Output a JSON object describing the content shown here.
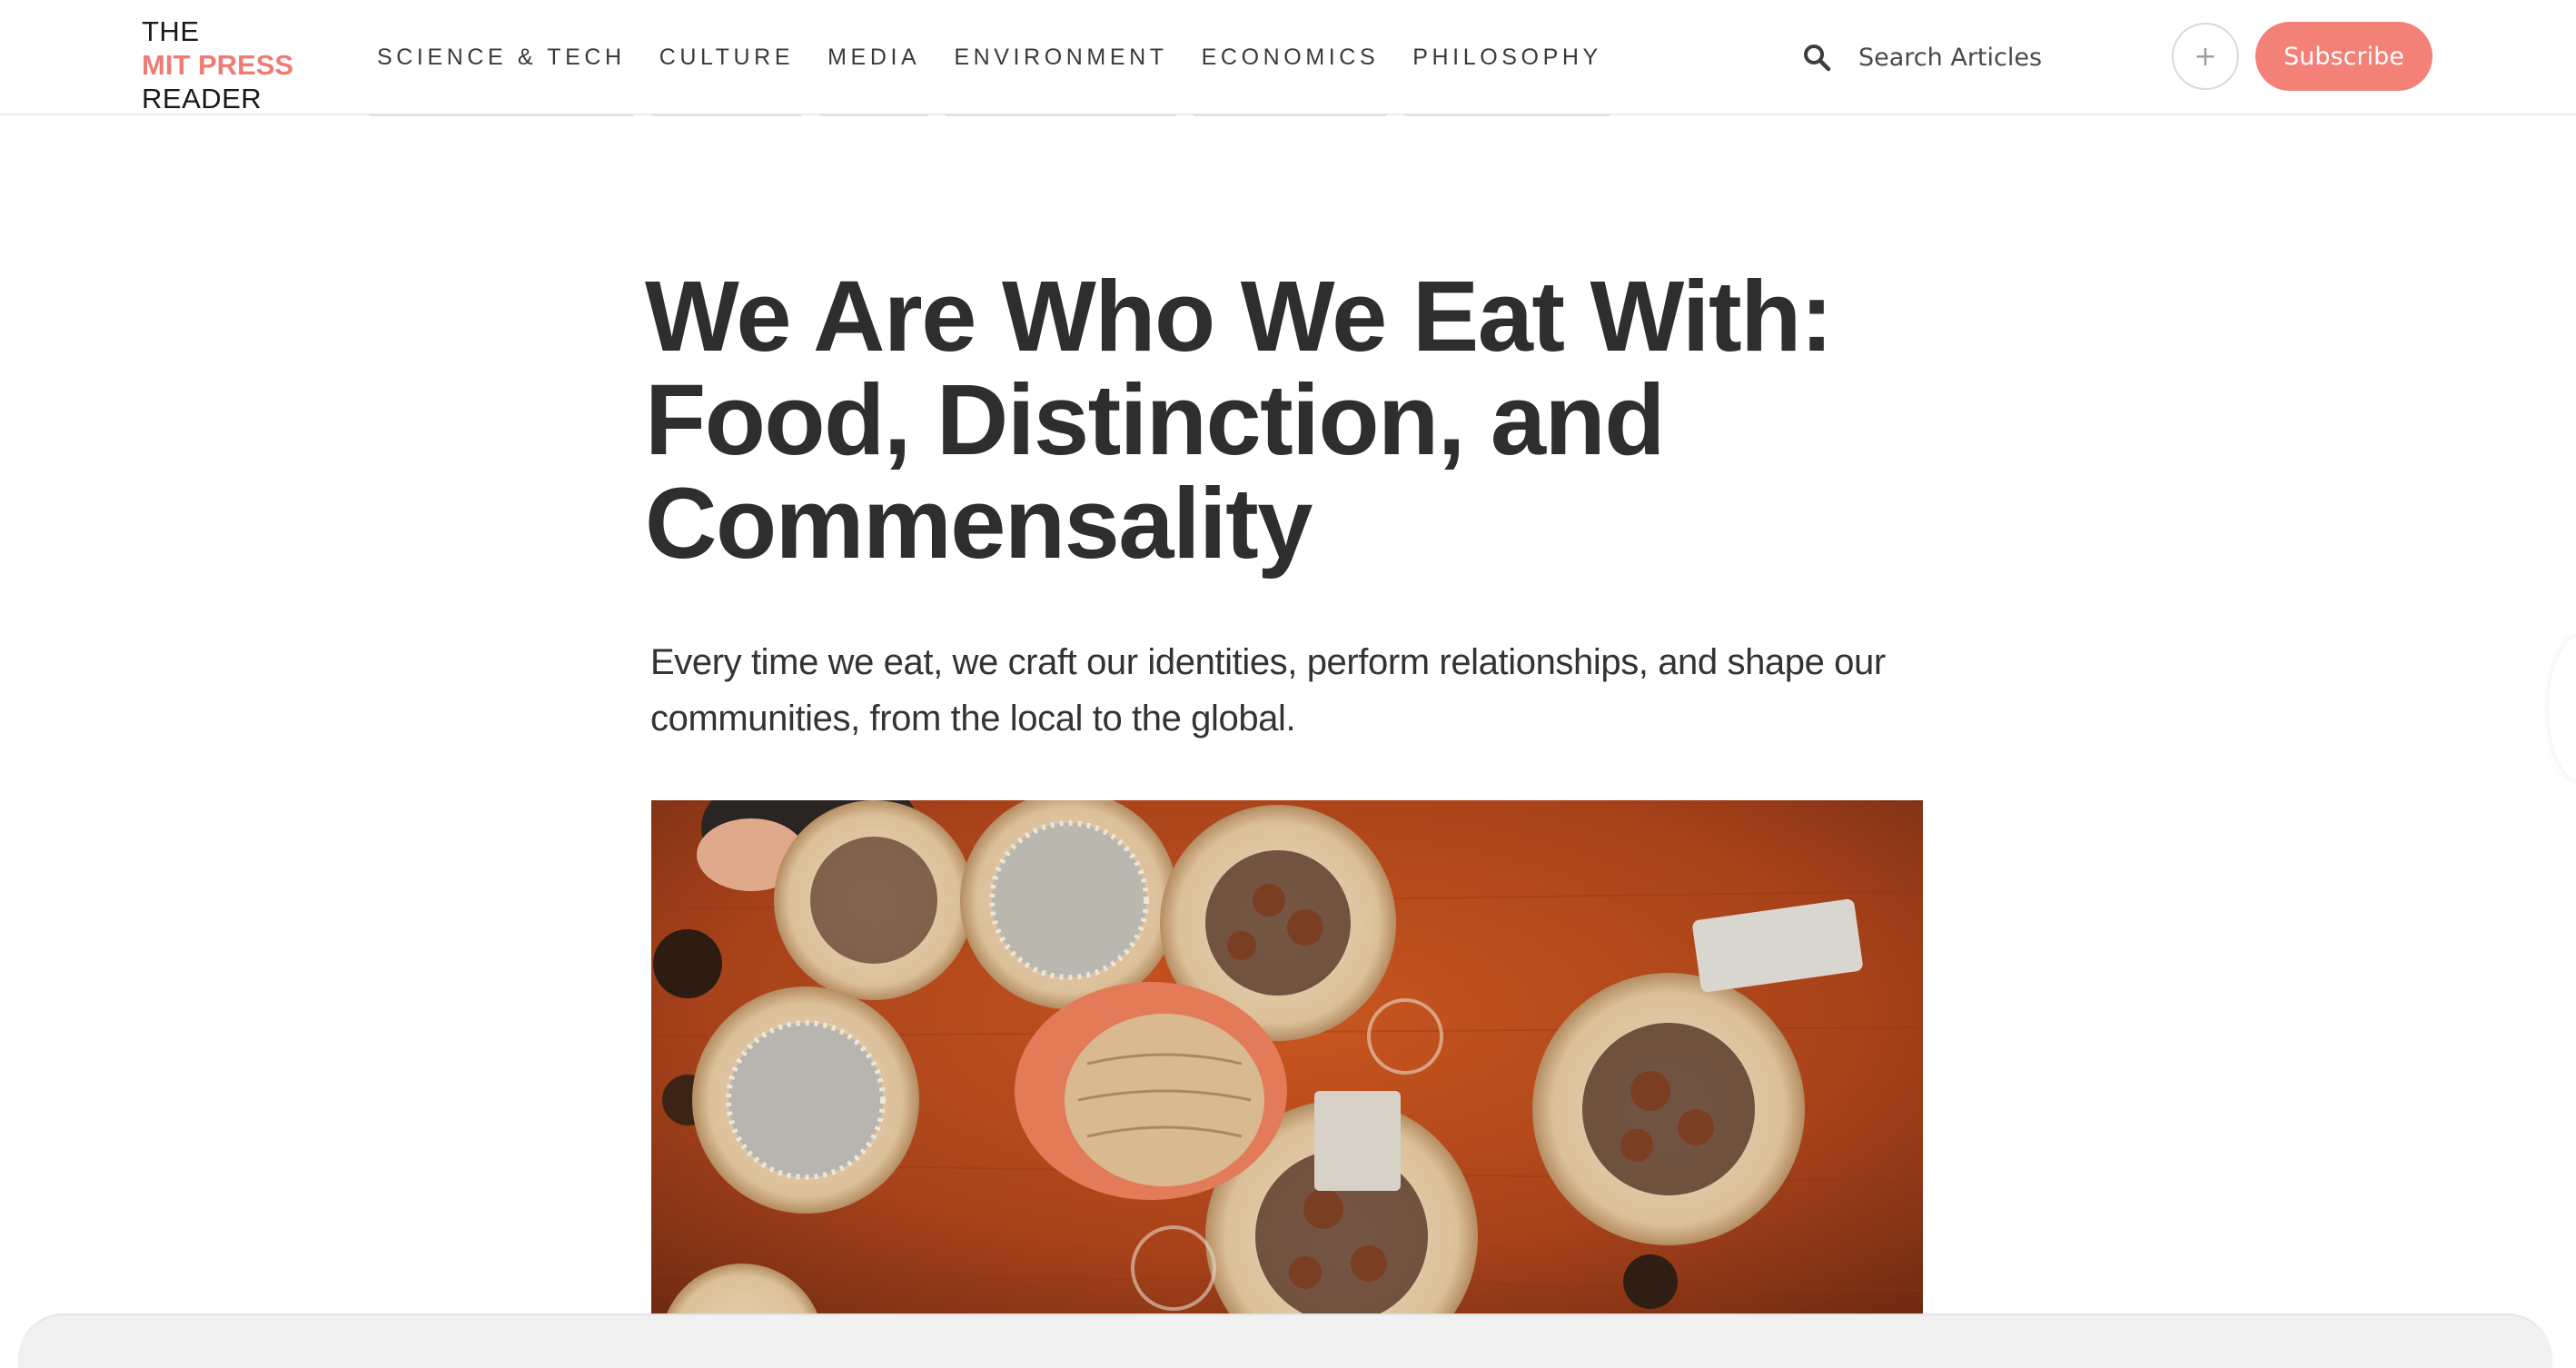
{
  "logo": {
    "line1": "THE",
    "line2": "MIT PRESS",
    "line3": "READER"
  },
  "nav": {
    "items": [
      {
        "label": "SCIENCE & TECH"
      },
      {
        "label": "CULTURE"
      },
      {
        "label": "MEDIA"
      },
      {
        "label": "ENVIRONMENT"
      },
      {
        "label": "ECONOMICS"
      },
      {
        "label": "PHILOSOPHY"
      }
    ]
  },
  "search": {
    "icon": "search-icon",
    "placeholder": "Search Articles"
  },
  "actions": {
    "plus_label": "+",
    "subscribe_label": "Subscribe"
  },
  "article": {
    "title": "We Are Who We Eat With: Food, Distinction, and Commensality",
    "dek": "Every time we eat, we craft our identities, perform relationships, and shape our communities, from the local to the global."
  },
  "colors": {
    "accent": "#f48178",
    "logo_accent": "#f27a74",
    "text": "#2e2e2e"
  }
}
